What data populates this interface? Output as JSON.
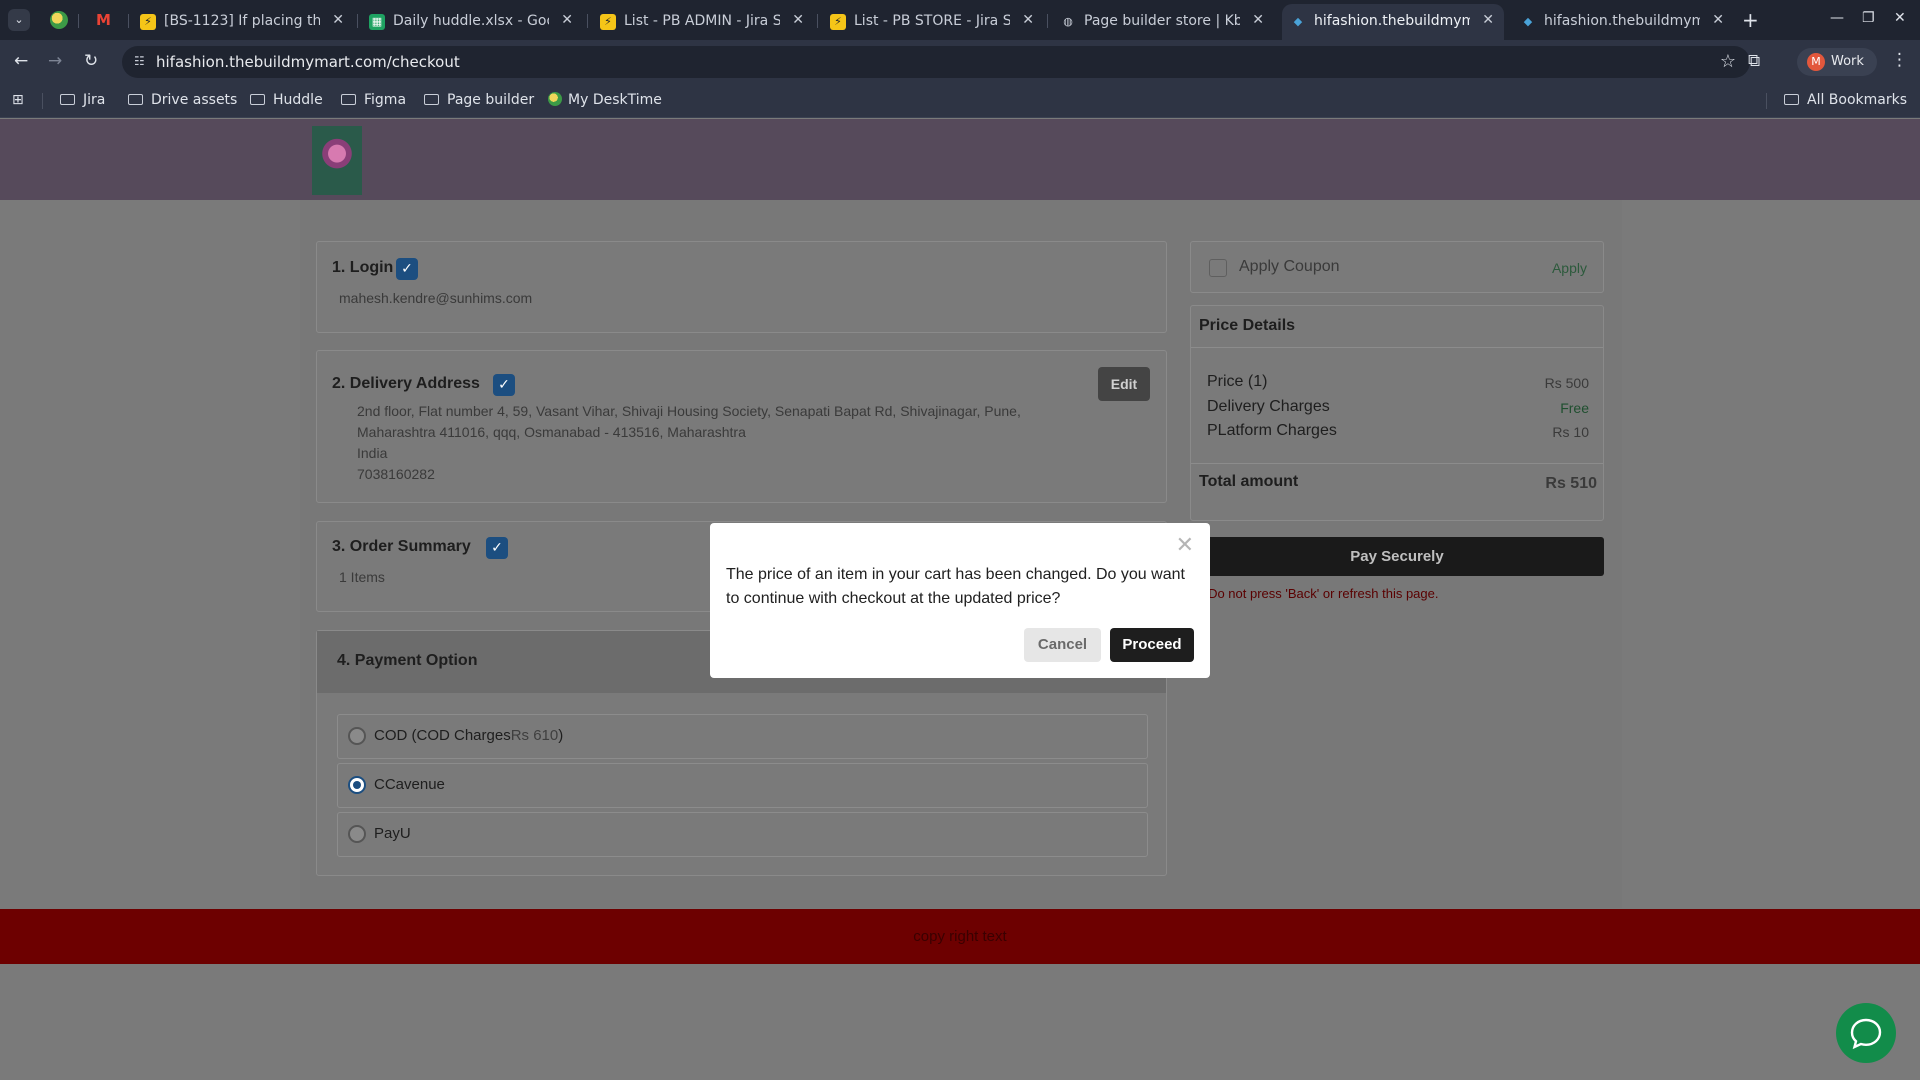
{
  "browser": {
    "tabs": [
      {
        "title": "[BS-1123] If placing the",
        "favicon": "jira-bolt-icon",
        "color": "#f5c518",
        "fav_glyph": "⚡"
      },
      {
        "title": "Daily huddle.xlsx - Goo",
        "favicon": "sheets-icon",
        "color": "#1ea362",
        "fav_glyph": "▦"
      },
      {
        "title": "List - PB ADMIN - Jira Se",
        "favicon": "jira-bolt-icon",
        "color": "#f5c518",
        "fav_glyph": "⚡"
      },
      {
        "title": "List - PB STORE - Jira Se",
        "favicon": "jira-bolt-icon",
        "color": "#f5c518",
        "fav_glyph": "⚡"
      },
      {
        "title": "Page builder store | Kb",
        "favicon": "globe-icon",
        "color": "#c9ced8",
        "fav_glyph": "◍"
      },
      {
        "title": "hifashion.thebuildmym",
        "favicon": "site-icon",
        "color": "#4aa3d8",
        "fav_glyph": "◆"
      },
      {
        "title": "hifashion.thebuildmym",
        "favicon": "site-icon",
        "color": "#4aa3d8",
        "fav_glyph": "◆"
      }
    ],
    "close_glyph": "✕",
    "url": "hifashion.thebuildmymart.com/checkout",
    "profile_initial": "M",
    "profile_name": "Work",
    "bookmarks": [
      "Jira",
      "Drive assets",
      "Huddle",
      "Figma",
      "Page builder",
      "My DeskTime"
    ],
    "all_bookmarks": "All Bookmarks"
  },
  "checkout": {
    "login": {
      "title": "1. Login",
      "email": "mahesh.kendre@sunhims.com"
    },
    "delivery": {
      "title": "2. Delivery Address",
      "edit_label": "Edit",
      "line1": "2nd floor, Flat number 4, 59, Vasant Vihar, Shivaji Housing Society, Senapati Bapat Rd, Shivajinagar, Pune,",
      "line2": "Maharashtra 411016, qqq, Osmanabad - 413516, Maharashtra",
      "country": "India",
      "phone": "7038160282"
    },
    "order_summary": {
      "title": "3. Order Summary",
      "items": "1 Items"
    },
    "payment": {
      "title": "4. Payment Option",
      "options": [
        {
          "label": "COD (COD Charges",
          "amount": "Rs 610",
          "suffix": ")",
          "selected": false
        },
        {
          "label": "CCavenue",
          "selected": true
        },
        {
          "label": "PayU",
          "selected": false
        }
      ]
    },
    "coupon": {
      "label": "Apply Coupon",
      "apply": "Apply"
    },
    "price_details": {
      "title": "Price Details",
      "rows": [
        {
          "label": "Price (1)",
          "value": "Rs 500"
        },
        {
          "label": "Delivery Charges",
          "value": "Free"
        },
        {
          "label": "PLatform Charges",
          "value": "Rs 10"
        }
      ],
      "total_label": "Total amount",
      "total_value": "Rs 510"
    },
    "pay_button": "Pay Securely",
    "note": "te: Do not press 'Back' or refresh this page."
  },
  "footer": {
    "text": "copy right text"
  },
  "modal": {
    "message": "The price of an item in your cart has been changed. Do you want to continue with checkout at the updated price?",
    "cancel": "Cancel",
    "proceed": "Proceed",
    "close": "✕"
  },
  "colors": {
    "check_blue": "#1c4e80",
    "footer_red": "#6d0000",
    "chat_green": "#128c4a"
  }
}
